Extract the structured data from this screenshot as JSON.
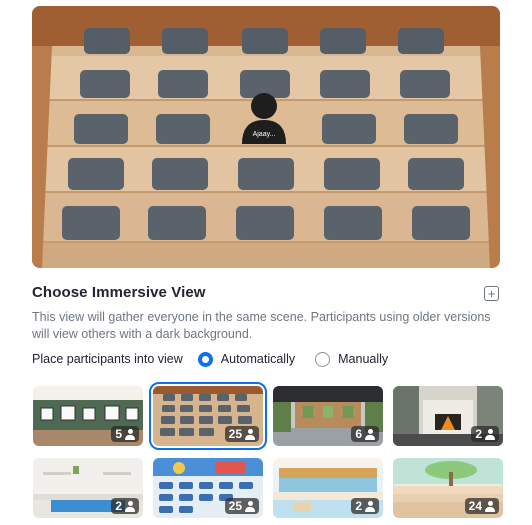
{
  "hero": {
    "participant_name": "Ajaay..."
  },
  "heading": {
    "title": "Choose Immersive View",
    "add_icon": "plus-square-icon",
    "description": "This view will gather everyone in the same scene. Participants using older versions will view others with a dark background."
  },
  "placement": {
    "label": "Place participants into view",
    "options": [
      {
        "label": "Automatically",
        "checked": true
      },
      {
        "label": "Manually",
        "checked": false
      }
    ]
  },
  "scenes": [
    {
      "name": "gallery-room",
      "count": "5",
      "selected": false
    },
    {
      "name": "auditorium",
      "count": "25",
      "selected": true
    },
    {
      "name": "cafe",
      "count": "6",
      "selected": false
    },
    {
      "name": "fireplace",
      "count": "2",
      "selected": false
    },
    {
      "name": "kitchen",
      "count": "2",
      "selected": false
    },
    {
      "name": "classroom",
      "count": "25",
      "selected": false
    },
    {
      "name": "diner",
      "count": "2",
      "selected": false
    },
    {
      "name": "garden-stage",
      "count": "24",
      "selected": false
    }
  ],
  "colors": {
    "accent": "#0e71eb",
    "text": "#232333",
    "muted": "#6e7680"
  }
}
